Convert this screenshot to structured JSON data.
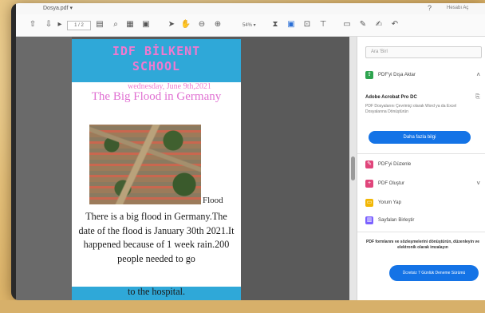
{
  "titlebar": {
    "tab": "Dosya.pdf  ▾",
    "help": "?",
    "user": "Hesabı Aç"
  },
  "toolbar": {
    "page_indicator": "1 / 2",
    "zoom": "54%  ▾"
  },
  "document": {
    "banner_line1": "IDF BİLKENT",
    "banner_line2": "SCHOOL",
    "date": "wednesday, June 9th,2021",
    "title": "The Big Flood in Germany",
    "photo_caption": "Flood",
    "body": "There is a big flood in Germany.The date of the flood is January 30th 2021.It happened because of 1 week rain.200 people needed to go",
    "footer": "to the hospital."
  },
  "panel": {
    "search_placeholder": "Ara 'Birl",
    "export_label": "PDF'yi Dışa Aktar",
    "acrobat_title": "Adobe Acrobat Pro DC",
    "acrobat_desc": "PDF Dosyalarını Çevrimiçi olarak Word ya da Excel Dosyalarına Dönüştürün",
    "more_info": "Daha fazla bilgi",
    "edit_pdf": "PDF'yi Düzenle",
    "create_pdf": "PDF Oluştur",
    "comment": "Yorum Yap",
    "organize": "Sayfaları Birleştir",
    "promo": "PDF formlarını ve sözleşmelerini dönüştürün, düzenleyin ve elektronik olarak imzalayın",
    "trial_button": "Ücretsiz 7 Günlük Deneme Sürümü"
  },
  "colors": {
    "banner": "#2fa8d8",
    "banner_text": "#f07ad0",
    "accent": "#1473e6"
  }
}
